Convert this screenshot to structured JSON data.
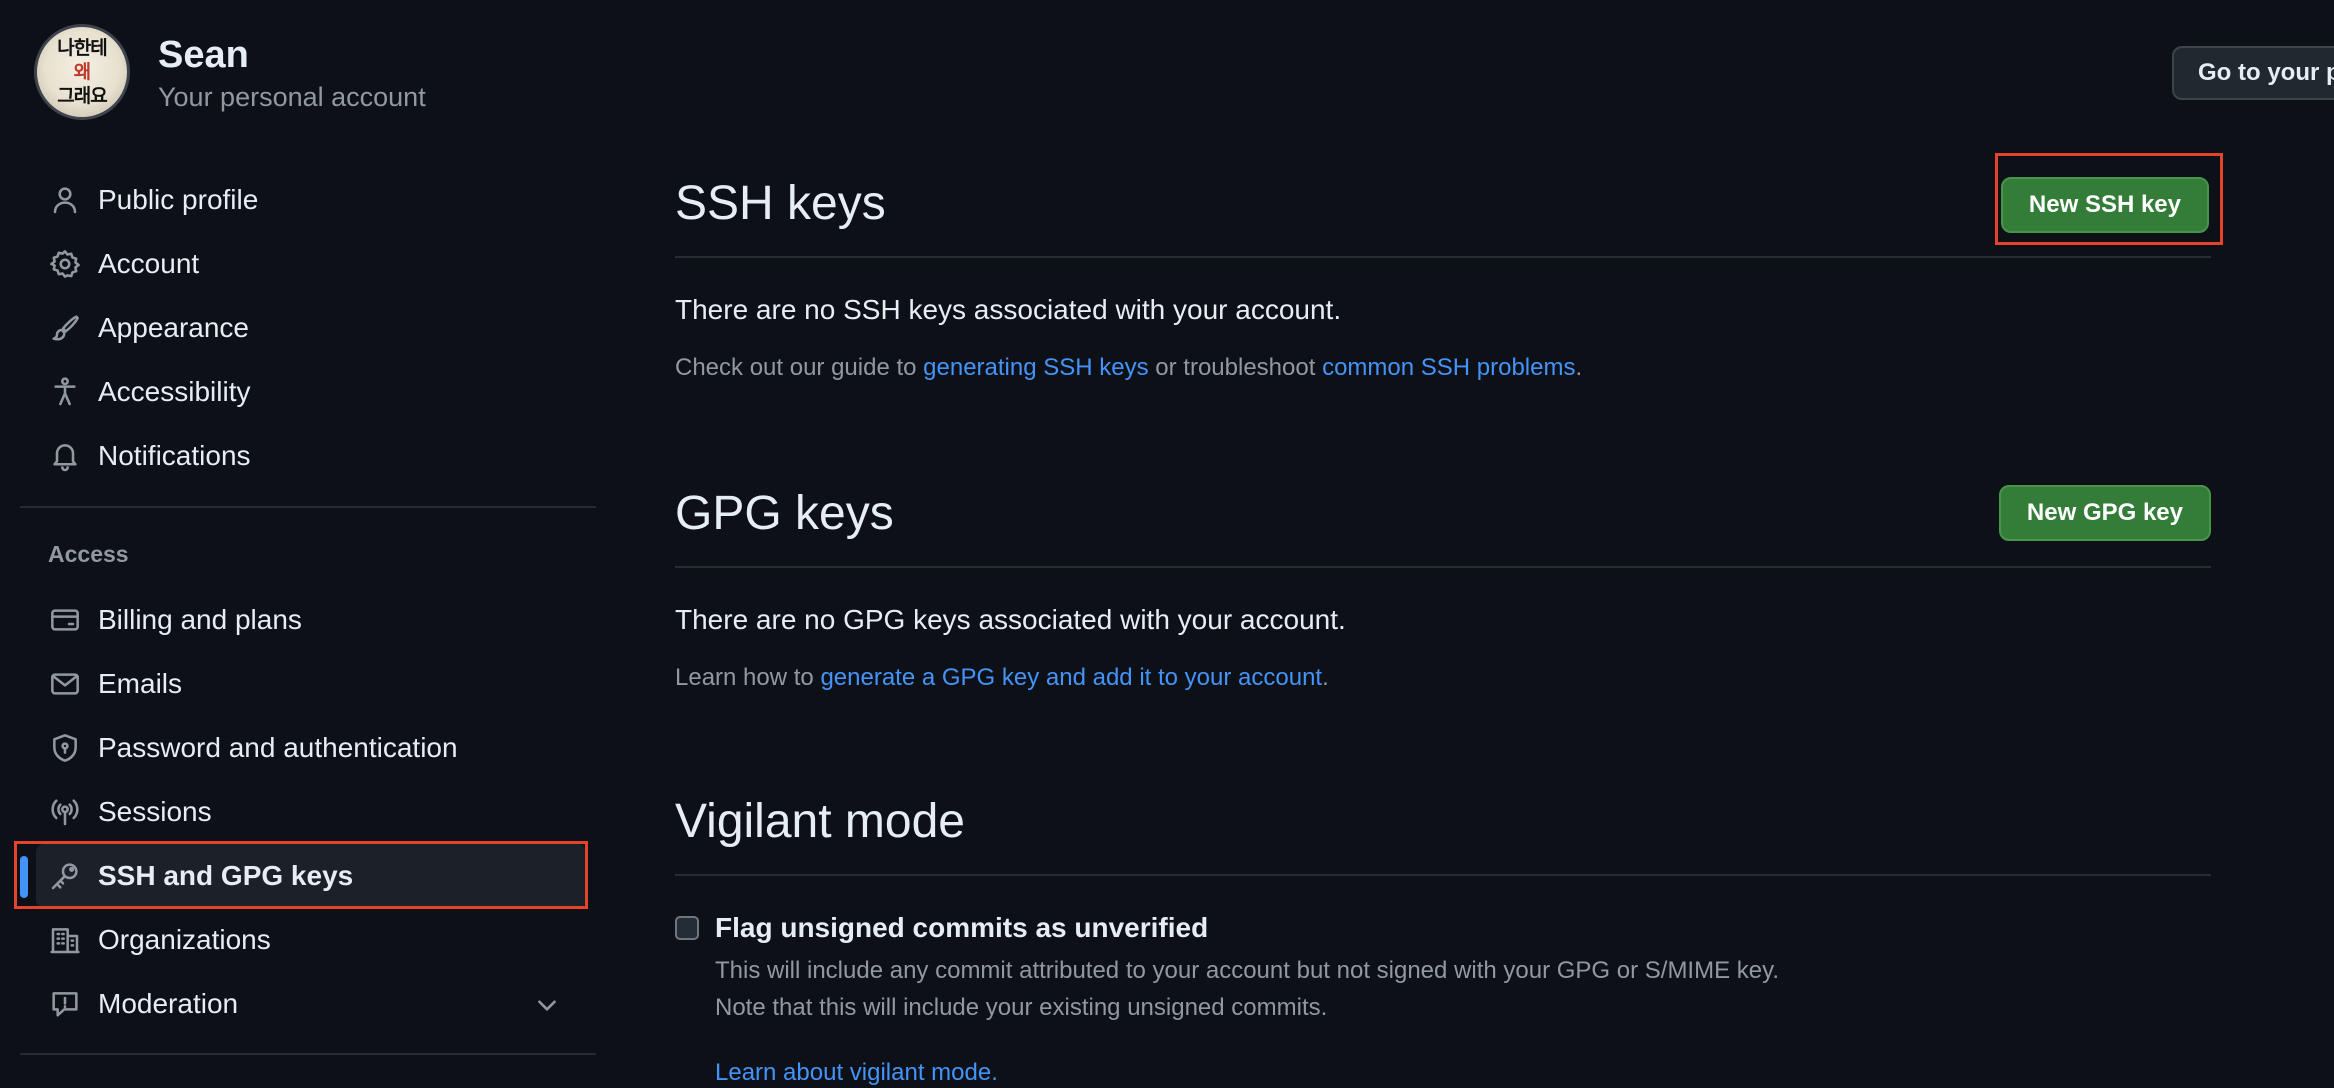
{
  "header": {
    "user_name": "Sean",
    "subtitle": "Your personal account",
    "goto_button": "Go to your p",
    "avatar_lines": [
      "나한테",
      "왜",
      "그래요"
    ]
  },
  "sidebar": {
    "top_items": [
      {
        "label": "Public profile",
        "icon": "person-icon"
      },
      {
        "label": "Account",
        "icon": "gear-icon"
      },
      {
        "label": "Appearance",
        "icon": "paintbrush-icon"
      },
      {
        "label": "Accessibility",
        "icon": "accessibility-icon"
      },
      {
        "label": "Notifications",
        "icon": "bell-icon"
      }
    ],
    "access_label": "Access",
    "access_items": [
      {
        "label": "Billing and plans",
        "icon": "credit-card-icon"
      },
      {
        "label": "Emails",
        "icon": "mail-icon"
      },
      {
        "label": "Password and authentication",
        "icon": "shield-lock-icon"
      },
      {
        "label": "Sessions",
        "icon": "broadcast-icon"
      },
      {
        "label": "SSH and GPG keys",
        "icon": "key-icon",
        "active": true
      },
      {
        "label": "Organizations",
        "icon": "organization-icon"
      },
      {
        "label": "Moderation",
        "icon": "report-icon",
        "expandable": true
      }
    ]
  },
  "ssh": {
    "title": "SSH keys",
    "button": "New SSH key",
    "empty": "There are no SSH keys associated with your account.",
    "guide_prefix": "Check out our guide to ",
    "guide_link1": "generating SSH keys",
    "guide_middle": " or troubleshoot ",
    "guide_link2": "common SSH problems",
    "guide_suffix": "."
  },
  "gpg": {
    "title": "GPG keys",
    "button": "New GPG key",
    "empty": "There are no GPG keys associated with your account.",
    "learn_prefix": "Learn how to ",
    "learn_link": "generate a GPG key and add it to your account",
    "learn_suffix": "."
  },
  "vigilant": {
    "title": "Vigilant mode",
    "checkbox_label": "Flag unsigned commits as unverified",
    "checked": false,
    "desc_line1": "This will include any commit attributed to your account but not signed with your GPG or S/MIME key.",
    "desc_line2": "Note that this will include your existing unsigned commits.",
    "learn_link": "Learn about vigilant mode."
  },
  "colors": {
    "background": "#0d1117",
    "accent_link": "#4493f8",
    "primary_button": "#347d39",
    "annotation_box": "#e5432b"
  }
}
